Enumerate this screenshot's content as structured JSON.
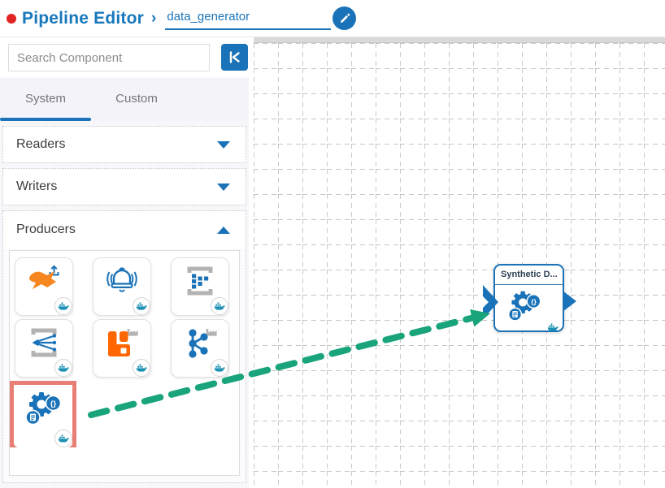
{
  "header": {
    "title": "Pipeline Editor",
    "separator": "›",
    "pipeline_name": "data_generator",
    "status_dot_color": "#e02424"
  },
  "sidebar": {
    "search_placeholder": "Search Component",
    "tabs": [
      {
        "label": "System",
        "active": true
      },
      {
        "label": "Custom",
        "active": false
      }
    ],
    "sections": [
      {
        "label": "Readers",
        "expanded": false
      },
      {
        "label": "Writers",
        "expanded": false
      },
      {
        "label": "Producers",
        "expanded": true
      }
    ],
    "producer_components": [
      {
        "icon": "publish-icon",
        "docker_badge": true
      },
      {
        "icon": "alert-bell-icon",
        "docker_badge": true
      },
      {
        "icon": "grid-list-icon",
        "docker_badge": true
      },
      {
        "icon": "merge-lines-icon",
        "docker_badge": true
      },
      {
        "icon": "rabbitmq-icon",
        "docker_badge": true,
        "factory_badge": true
      },
      {
        "icon": "kafka-icon",
        "docker_badge": true,
        "factory_badge": true
      },
      {
        "icon": "gear-braces-icon",
        "docker_badge": true,
        "selected": true
      }
    ]
  },
  "canvas": {
    "node": {
      "title": "Synthetic D...",
      "icon": "gear-braces-icon",
      "docker_badge": true
    }
  },
  "icons": {
    "braces_glyph": "{}"
  },
  "colors": {
    "primary_blue": "#1a73b8",
    "header_text_blue": "#1878bc",
    "selection_red": "#e87f76",
    "drag_arrow_green": "#19a47c",
    "icon_orange": "#f6861f",
    "rabbitmq_orange": "#ff6600",
    "icon_gray": "#b3b3b3",
    "docker_teal": "#1d91b4",
    "grid_line_gray": "#b3b3b3"
  }
}
